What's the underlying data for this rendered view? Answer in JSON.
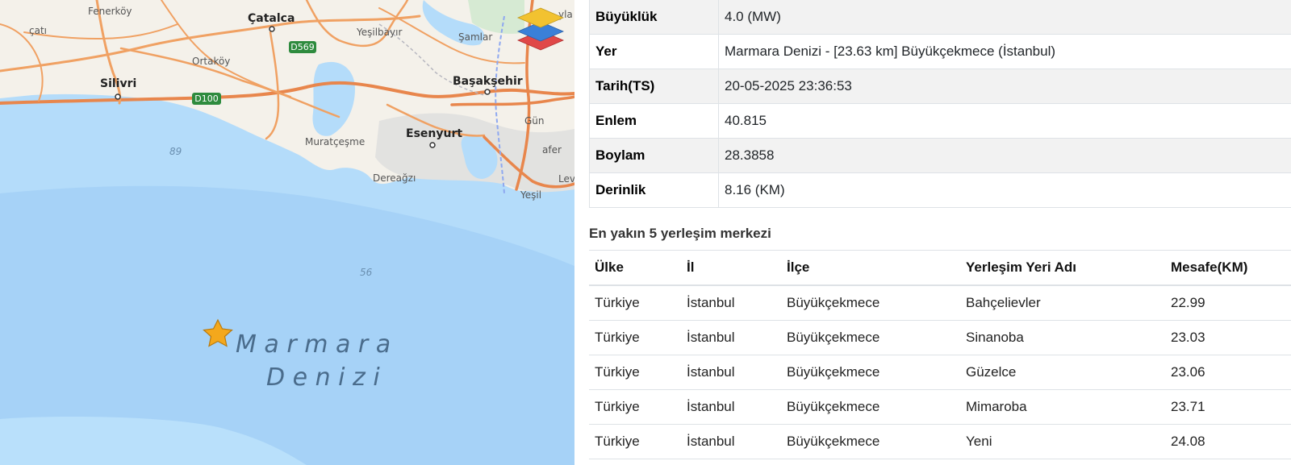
{
  "map": {
    "places": {
      "fenerkoy": "Fenerköy",
      "catalca": "Çatalca",
      "cati": "çatı",
      "yesilbayir": "Yeşilbayır",
      "samlar": "Şamlar",
      "ortakoy": "Ortaköy",
      "silivri": "Silivri",
      "basaksehir": "Başakşehir",
      "muratcesme": "Muratçeşme",
      "esenyurt": "Esenyurt",
      "dereagzi": "Dereağzı",
      "gun": "Gün",
      "afer": "afer",
      "yesil": "Yeşil",
      "yla": "yla",
      "lev": "Lev"
    },
    "roads": {
      "d569": "D569",
      "d100": "D100"
    },
    "depths": {
      "d89": "89",
      "d56": "56"
    },
    "sea_line1": "M a r m a r a",
    "sea_line2": "D e n i z i",
    "icons": [
      "star-icon",
      "layers-icon"
    ],
    "colors": {
      "water": "#a9d4f7",
      "land": "#f4f1ea",
      "road": "#f0a163",
      "highway": "#e8864c",
      "star": "#f4a81c"
    }
  },
  "details": [
    {
      "label": "Büyüklük",
      "value": "4.0 (MW)"
    },
    {
      "label": "Yer",
      "value": "Marmara Denizi - [23.63 km] Büyükçekmece (İstanbul)"
    },
    {
      "label": "Tarih(TS)",
      "value": "20-05-2025 23:36:53"
    },
    {
      "label": "Enlem",
      "value": "40.815"
    },
    {
      "label": "Boylam",
      "value": "28.3858"
    },
    {
      "label": "Derinlik",
      "value": "8.16 (KM)"
    }
  ],
  "nearest": {
    "title": "En yakın 5 yerleşim merkezi",
    "headers": [
      "Ülke",
      "İl",
      "İlçe",
      "Yerleşim Yeri Adı",
      "Mesafe(KM)"
    ],
    "rows": [
      [
        "Türkiye",
        "İstanbul",
        "Büyükçekmece",
        "Bahçelievler",
        "22.99"
      ],
      [
        "Türkiye",
        "İstanbul",
        "Büyükçekmece",
        "Sinanoba",
        "23.03"
      ],
      [
        "Türkiye",
        "İstanbul",
        "Büyükçekmece",
        "Güzelce",
        "23.06"
      ],
      [
        "Türkiye",
        "İstanbul",
        "Büyükçekmece",
        "Mimaroba",
        "23.71"
      ],
      [
        "Türkiye",
        "İstanbul",
        "Büyükçekmece",
        "Yeni",
        "24.08"
      ]
    ]
  }
}
